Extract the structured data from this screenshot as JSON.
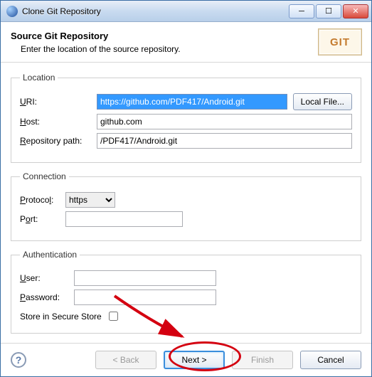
{
  "titlebar": {
    "title": "Clone Git Repository"
  },
  "header": {
    "title": "Source Git Repository",
    "subtitle": "Enter the location of the source repository.",
    "badge": "GIT"
  },
  "location": {
    "legend": "Location",
    "uri_label": "URI:",
    "uri_value": "https://github.com/PDF417/Android.git",
    "local_file_btn": "Local File...",
    "host_label": "Host:",
    "host_value": "github.com",
    "repo_path_label": "Repository path:",
    "repo_path_value": "/PDF417/Android.git"
  },
  "connection": {
    "legend": "Connection",
    "protocol_label": "Protocol:",
    "protocol_value": "https",
    "port_label": "Port:",
    "port_value": ""
  },
  "authentication": {
    "legend": "Authentication",
    "user_label": "User:",
    "user_value": "",
    "password_label": "Password:",
    "password_value": "",
    "store_label": "Store in Secure Store"
  },
  "buttons": {
    "back": "< Back",
    "next": "Next >",
    "finish": "Finish",
    "cancel": "Cancel"
  }
}
